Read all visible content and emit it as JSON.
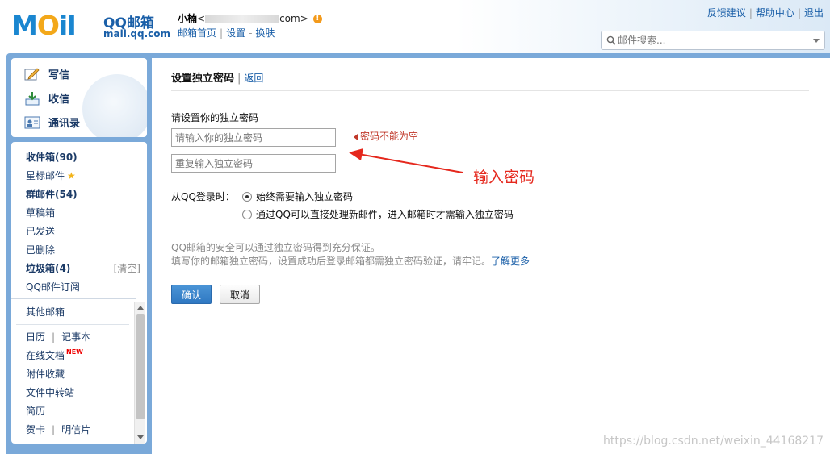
{
  "header": {
    "logo_text": "MOil",
    "logo_title": "QQ邮箱",
    "logo_sub": "mail.qq.com",
    "user_name": "小楠",
    "user_email_prefix": "<",
    "user_email_suffix": "com>",
    "links": [
      "邮箱首页",
      "设置",
      "换肤"
    ],
    "top_right": [
      "反馈建议",
      "帮助中心",
      "退出"
    ],
    "search_placeholder": "邮件搜索..."
  },
  "sidebar": {
    "actions": [
      {
        "label": "写信",
        "icon": "compose-icon"
      },
      {
        "label": "收信",
        "icon": "inbox-download-icon"
      },
      {
        "label": "通讯录",
        "icon": "contacts-icon"
      }
    ],
    "folders": [
      {
        "label": "收件箱(90)",
        "bold": true
      },
      {
        "label": "星标邮件",
        "bold": false
      },
      {
        "label": "群邮件(54)",
        "bold": true
      },
      {
        "label": "草稿箱",
        "bold": false
      },
      {
        "label": "已发送",
        "bold": false
      },
      {
        "label": "已删除",
        "bold": false
      },
      {
        "label": "垃圾箱(4)",
        "bold": true
      },
      {
        "label": "QQ邮件订阅",
        "bold": false
      }
    ],
    "clear_label": "[清空]",
    "other_mailboxes": "其他邮箱",
    "calendar": "日历",
    "notes": "记事本",
    "online_docs": "在线文档",
    "new_badge": "NEW",
    "attachments": "附件收藏",
    "transfer": "文件中转站",
    "resume": "简历",
    "greeting_card": "贺卡",
    "postcard": "明信片",
    "sep": "|"
  },
  "main": {
    "title": "设置独立密码",
    "back": "返回",
    "prompt": "请设置你的独立密码",
    "input1_placeholder": "请输入你的独立密码",
    "input2_placeholder": "重复输入独立密码",
    "error": "密码不能为空",
    "annotation": "输入密码",
    "login_label": "从QQ登录时：",
    "radio1": "始终需要输入独立密码",
    "radio2": "通过QQ可以直接处理新邮件，进入邮箱时才需输入独立密码",
    "tip1": "QQ邮箱的安全可以通过独立密码得到充分保证。",
    "tip2": "填写你的邮箱独立密码，设置成功后登录邮箱都需独立密码验证，请牢记。",
    "tip_link": "了解更多",
    "confirm": "确认",
    "cancel": "取消"
  },
  "watermark": "https://blog.csdn.net/weixin_44168217"
}
